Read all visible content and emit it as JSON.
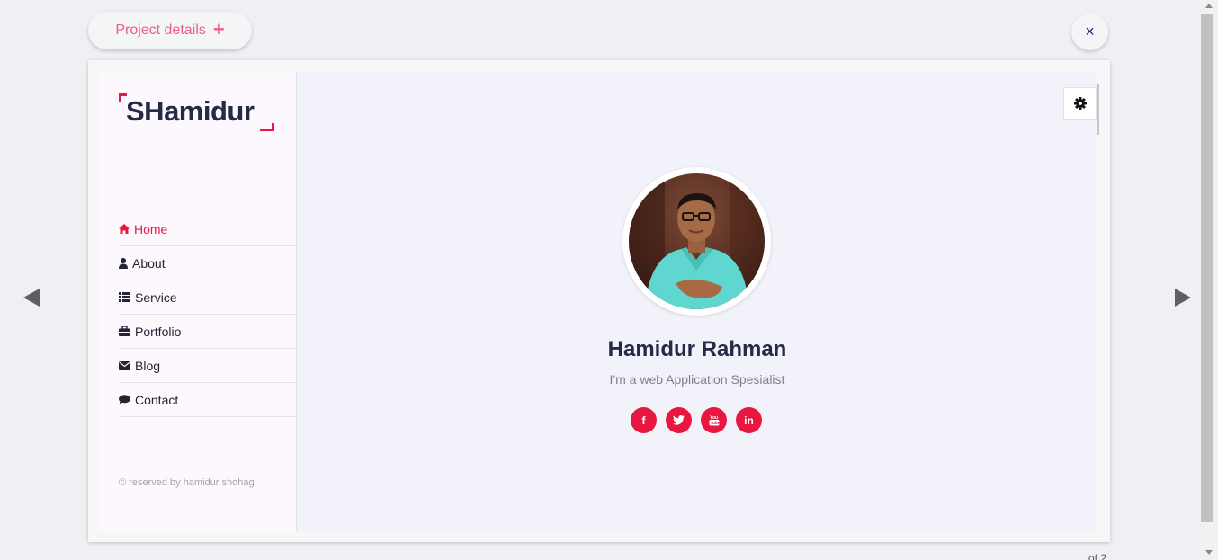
{
  "topbar": {
    "project_details_label": "Project details",
    "close_label": "×"
  },
  "navigation": {
    "prev_icon": "triangle-left-icon",
    "next_icon": "triangle-right-icon"
  },
  "sidebar": {
    "logo_text": "SHamidur",
    "items": [
      {
        "label": "Home",
        "icon": "home-icon",
        "active": true
      },
      {
        "label": "About",
        "icon": "user-icon",
        "active": false
      },
      {
        "label": "Service",
        "icon": "list-icon",
        "active": false
      },
      {
        "label": "Portfolio",
        "icon": "briefcase-icon",
        "active": false
      },
      {
        "label": "Blog",
        "icon": "envelope-icon",
        "active": false
      },
      {
        "label": "Contact",
        "icon": "comment-icon",
        "active": false
      }
    ],
    "copyright": "© reserved by hamidur shohag"
  },
  "hero": {
    "name": "Hamidur Rahman",
    "tagline": "I'm a web Application Spesialist",
    "socials": [
      {
        "icon": "facebook-icon",
        "glyph": "f"
      },
      {
        "icon": "twitter-icon",
        "glyph": ""
      },
      {
        "icon": "youtube-icon",
        "glyph": ""
      },
      {
        "icon": "linkedin-icon",
        "glyph": "in"
      }
    ]
  },
  "footer": {
    "counter_text": "of 2"
  },
  "colors": {
    "accent": "#e8173f",
    "pink_button_text": "#ec5f86",
    "heading": "#272a46",
    "muted": "#80808c"
  }
}
